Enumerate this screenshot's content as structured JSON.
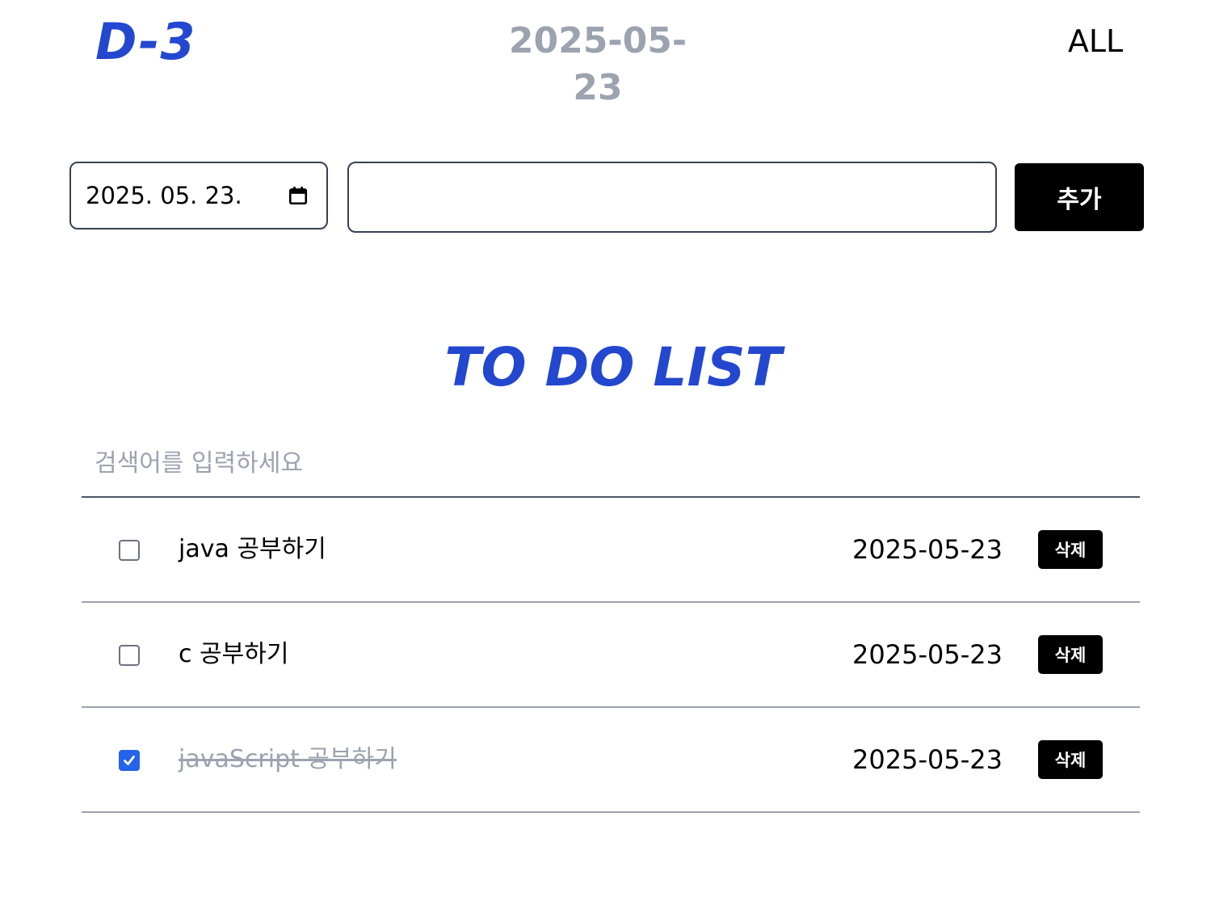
{
  "header": {
    "logo": "D-3",
    "date": "2025-05-23",
    "filter_label": "ALL"
  },
  "form": {
    "date_value": "2025. 05. 23.",
    "todo_value": "",
    "add_label": "추가"
  },
  "list": {
    "title": "TO DO LIST",
    "search_placeholder": "검색어를 입력하세요",
    "delete_label": "삭제",
    "items": [
      {
        "text": "java 공부하기",
        "date": "2025-05-23",
        "done": false
      },
      {
        "text": "c 공부하기",
        "date": "2025-05-23",
        "done": false
      },
      {
        "text": "javaScript 공부하기",
        "date": "2025-05-23",
        "done": true
      }
    ]
  },
  "colors": {
    "accent": "#2447d0",
    "muted": "#9ca3af",
    "checkbox_checked": "#2563eb"
  }
}
